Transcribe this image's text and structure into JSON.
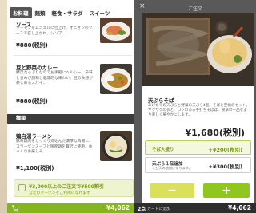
{
  "menu": {
    "tabs": [
      "お料理",
      "麺類",
      "軽食・サラダ",
      "スイーツ"
    ],
    "active_tab": 0,
    "items": [
      {
        "name": "ソース",
        "desc": "サーモンをムニエルに仕上げ、オニオンのソースで召し上がれ。シンプ...",
        "price": "¥880(税別)"
      },
      {
        "name": "豆と野菜のカレー",
        "desc": "野菜たっぷりなのでお手軽にヘルシー。辛味と甘みが調和し健康的な味わい。豆の食感が楽しめるスパイ...",
        "price": "¥880(税別)"
      },
      {
        "name": "鶏白湯ラーメン",
        "desc": "豚骨鶏肉をじっくり煮込んだ濃厚な白湯に、コラーゲンスープと国産鶏を贅沢に使用。ゆっくりお楽しみ...",
        "price": "¥1,100(税別)"
      }
    ],
    "section_header": "麺類",
    "promo": {
      "main": "¥3,000以上のご注文で¥500割引",
      "sub": "なたのクーポンをご利用になれます"
    },
    "cart_total": "¥4,062"
  },
  "order": {
    "title": "ご注文",
    "dish": {
      "name": "天ぷらそば",
      "desc": "あげたての天ぷらと野菜の天ぷら4品、そばと至福のセット。サクサクの衣と、コシのある手打ちそばは、食卓の一品をより楽しく華やかにします。",
      "price": "¥1,680(税別)"
    },
    "options": [
      {
        "name": "そば大盛り",
        "sub": "",
        "price": "+¥200(税別)",
        "selected": true
      },
      {
        "name": "天ぷら１品追加",
        "sub": "えび天の追加になります。",
        "price": "+¥300(税別)",
        "selected": false
      }
    ],
    "minus_label": "−",
    "plus_label": "+",
    "bar": {
      "count": "2点",
      "label": "カートに追加",
      "total": "¥4,062"
    }
  },
  "colors": {
    "accent_green": "#85b51c",
    "accent_lime": "#dbe05a",
    "header_dark": "#3b3b3b"
  }
}
